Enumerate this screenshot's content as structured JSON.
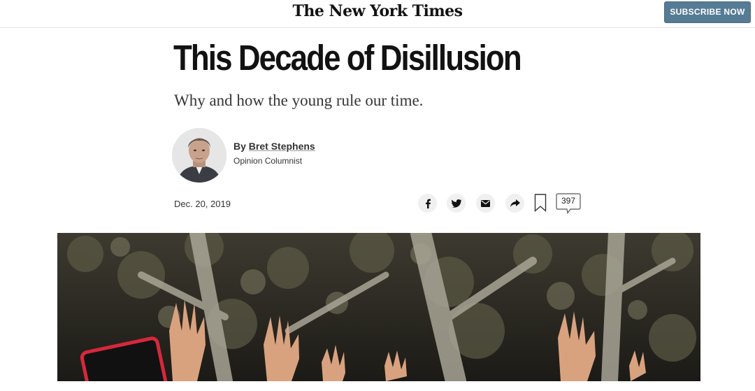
{
  "header": {
    "logo": "The New York Times",
    "subscribe_label": "SUBSCRIBE NOW"
  },
  "article": {
    "headline": "This Decade of Disillusion",
    "summary": "Why and how the young rule our time.",
    "byline_prefix": "By",
    "author": "Bret Stephens",
    "author_role": "Opinion Columnist",
    "date": "Dec. 20, 2019"
  },
  "share_tools": {
    "comment_count": "397",
    "icons": [
      "facebook-icon",
      "twitter-icon",
      "email-icon",
      "share-icon",
      "bookmark-icon",
      "comment-icon"
    ]
  },
  "colors": {
    "subscribe_bg": "#567b95",
    "text": "#121212",
    "share_bg": "#f0f0f0"
  }
}
